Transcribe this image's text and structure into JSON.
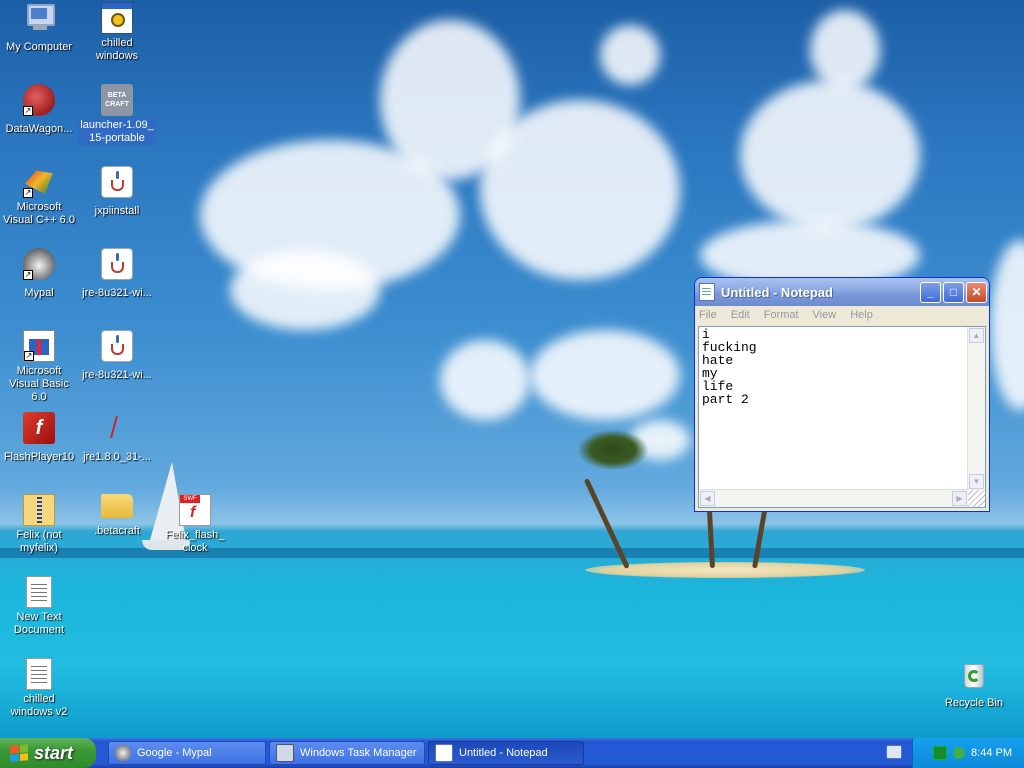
{
  "desktop": {
    "icons": [
      {
        "label": "My Computer"
      },
      {
        "label": "chilled windows"
      },
      {
        "label": "DataWagon..."
      },
      {
        "label": "launcher-1.09_ 15-portable"
      },
      {
        "label": "Microsoft Visual C++ 6.0"
      },
      {
        "label": "jxpiinstall"
      },
      {
        "label": "Mypal"
      },
      {
        "label": "jre-8u321-wi..."
      },
      {
        "label": "Microsoft Visual Basic 6.0"
      },
      {
        "label": "jre-8u321-wi..."
      },
      {
        "label": "FlashPlayer10"
      },
      {
        "label": "jre1.8.0_31-..."
      },
      {
        "label": "Felix (not myfelix)"
      },
      {
        "label": ".betacraft"
      },
      {
        "label": "Felix_flash_ clock"
      },
      {
        "label": "New Text Document"
      },
      {
        "label": "chilled windows v2"
      },
      {
        "label": "Recycle Bin"
      }
    ],
    "beta_icon_text": "BETA CRAFT",
    "swf_tag": "SWF"
  },
  "notepad": {
    "title": "Untitled - Notepad",
    "menu": [
      "File",
      "Edit",
      "Format",
      "View",
      "Help"
    ],
    "content": "i\nfucking\nhate\nmy\nlife\npart 2"
  },
  "taskbar": {
    "start_label": "start",
    "tasks": [
      {
        "label": "Google - Mypal"
      },
      {
        "label": "Windows Task Manager"
      },
      {
        "label": "Untitled - Notepad"
      }
    ],
    "clock": "8:44 PM"
  }
}
